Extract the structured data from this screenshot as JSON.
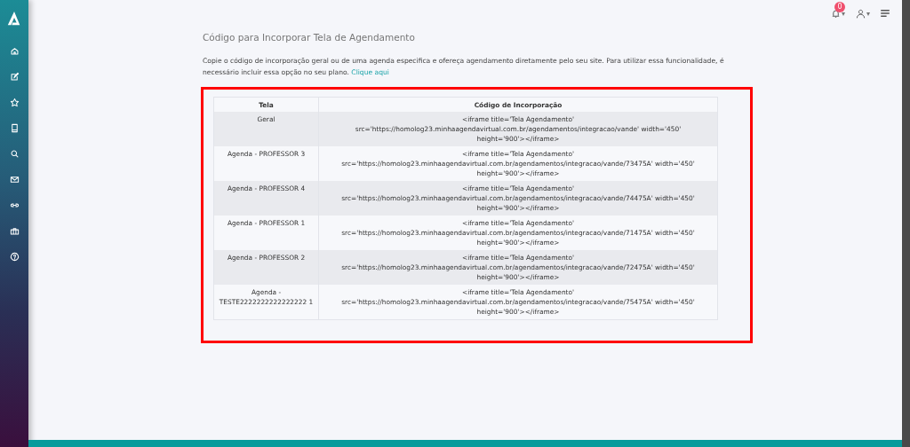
{
  "topbar": {
    "notifications_count": "0",
    "bell_caret": "▾",
    "user_caret": "▾"
  },
  "page": {
    "title": "Código para Incorporar Tela de Agendamento",
    "description": "Copie o código de incorporação geral ou de uma agenda especifica e ofereça agendamento diretamente pelo seu site. Para utilizar essa funcionalidade, é necessário incluir essa opção no seu plano.",
    "link": "Clique aqui"
  },
  "table": {
    "columns": [
      "Tela",
      "Código de Incorporação"
    ],
    "rows": [
      {
        "tela": "Geral",
        "code": "<iframe title='Tela Agendamento' src='https://homolog23.minhaagendavirtual.com.br/agendamentos/integracao/vande' width='450' height='900'></iframe>"
      },
      {
        "tela": "Agenda - PROFESSOR 3",
        "code": "<iframe title='Tela Agendamento' src='https://homolog23.minhaagendavirtual.com.br/agendamentos/integracao/vande/73475A' width='450' height='900'></iframe>"
      },
      {
        "tela": "Agenda - PROFESSOR 4",
        "code": "<iframe title='Tela Agendamento' src='https://homolog23.minhaagendavirtual.com.br/agendamentos/integracao/vande/74475A' width='450' height='900'></iframe>"
      },
      {
        "tela": "Agenda - PROFESSOR 1",
        "code": "<iframe title='Tela Agendamento' src='https://homolog23.minhaagendavirtual.com.br/agendamentos/integracao/vande/71475A' width='450' height='900'></iframe>"
      },
      {
        "tela": "Agenda - PROFESSOR 2",
        "code": "<iframe title='Tela Agendamento' src='https://homolog23.minhaagendavirtual.com.br/agendamentos/integracao/vande/72475A' width='450' height='900'></iframe>"
      },
      {
        "tela": "Agenda - TESTE2222222222222222 1",
        "code": "<iframe title='Tela Agendamento' src='https://homolog23.minhaagendavirtual.com.br/agendamentos/integracao/vande/75475A' width='450' height='900'></iframe>"
      }
    ]
  }
}
